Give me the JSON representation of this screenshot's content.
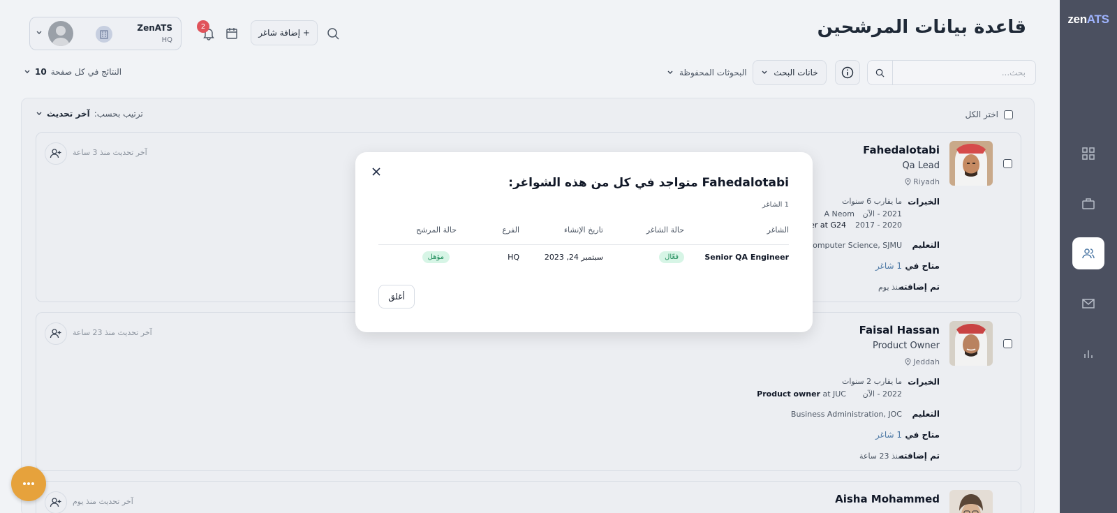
{
  "app": {
    "logo_zen": "zen",
    "logo_ats": "ATS",
    "title": "قاعدة بيانات المرشحين"
  },
  "header": {
    "org_name": "ZenATS",
    "org_branch": "HQ",
    "notifications_count": "2",
    "add_job_label": "+ إضافة شاغر"
  },
  "toolbar": {
    "search_placeholder": "بحث...",
    "search_fields_label": "خانات البحث",
    "saved_searches_label": "البحوثات المحفوظة",
    "per_page_label": "النتائج في كل صفحة",
    "per_page_value": "10"
  },
  "results": {
    "select_all_label": "اختر الكل",
    "sort_label": "ترتيب بحسب:",
    "sort_value": "آخر تحديث"
  },
  "labels": {
    "experience": "الخبرات",
    "education": "التعليم",
    "available_in": "متاح في",
    "added": "تم إضافته"
  },
  "candidates": [
    {
      "name": "Fahedalotabi",
      "role": "Qa Lead",
      "location": "Riyadh",
      "experience_total": "ما يقارب 6 سنوات",
      "exp1_period": "2021 - الآن",
      "exp1_text": "A Neom",
      "exp2_period": "2020 - 2017",
      "exp2_text": "er at G24",
      "education": "Computer Science, SJMU",
      "available": "1 شاغر",
      "added": "منذ يوم",
      "updated": "آخر تحديث منذ 3 ساعة"
    },
    {
      "name": "Faisal Hassan",
      "role": "Product Owner",
      "location": "Jeddah",
      "experience_total": "ما يقارب 2 سنوات",
      "exp1_period": "2022 - الآن",
      "exp1_title": "Product owner",
      "exp1_company": " at JUC",
      "education": "Business Administration, JOC",
      "available": "1 شاغر",
      "added": "منذ 23 ساعة",
      "updated": "آخر تحديث منذ 23 ساعة"
    },
    {
      "name": "Aisha Mohammed",
      "updated": "آخر تحديث منذ يوم"
    }
  ],
  "modal": {
    "title": "Fahedalotabi متواجد في كل من هذه الشواغر:",
    "count": "1 الشاغر",
    "columns": [
      "الشاغر",
      "حالة الشاغر",
      "تاريخ الإنشاء",
      "الفرع",
      "حالة المرشح"
    ],
    "rows": [
      {
        "job": "Senior QA Engineer",
        "job_status": "فعّال",
        "created": "سبتمبر 24, 2023",
        "branch": "HQ",
        "candidate_status": "مؤهل"
      }
    ],
    "close_label": "أغلق"
  },
  "icons": {
    "sidebar": [
      "dashboard-icon",
      "briefcase-icon",
      "users-icon",
      "mail-icon",
      "bar-chart-icon"
    ],
    "header": [
      "chevron-down-icon",
      "building-icon",
      "bell-icon",
      "calendar-icon",
      "search-icon"
    ],
    "card": [
      "map-pin-icon",
      "user-plus-icon"
    ],
    "modal": [
      "close-icon"
    ],
    "fab": "more-icon"
  },
  "colors": {
    "sidebar": "#4b5060",
    "accent": "#9fb4ff",
    "badge": "#e0535b",
    "fab": "#e6a23c",
    "status_green": "#1e8c5a"
  }
}
